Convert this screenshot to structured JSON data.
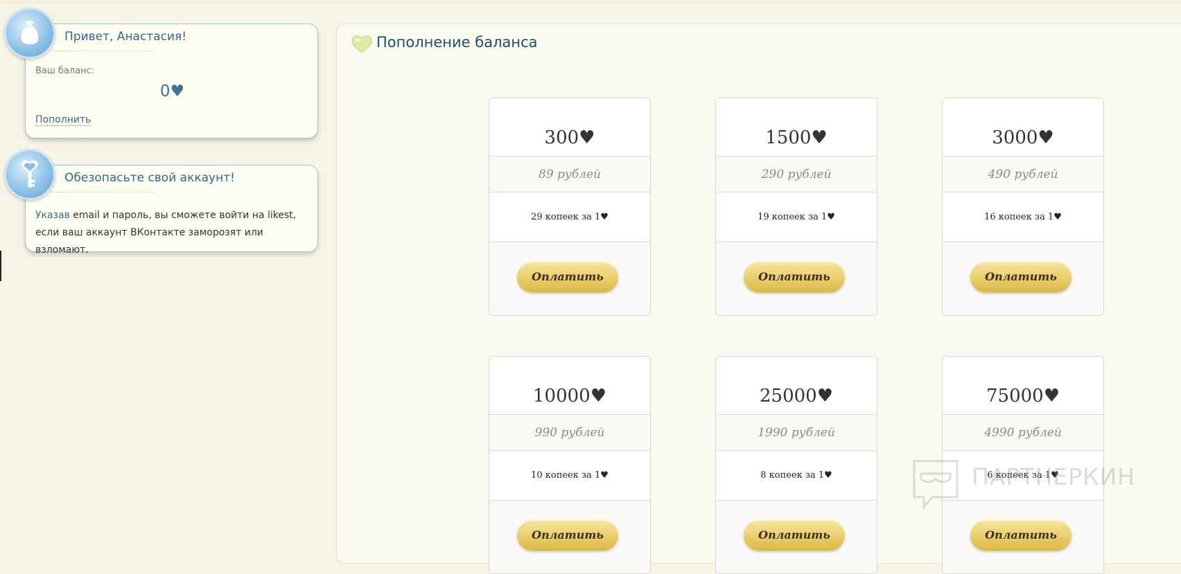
{
  "greeting": {
    "title": "Привет, Анастасия!",
    "balance_label": "Ваш баланс:",
    "balance_value": "0♥",
    "topup_link": "Пополнить"
  },
  "security": {
    "title": "Обезопасьте свой аккаунт!",
    "text_lead": "Указав",
    "text_rest": " email и пароль, вы сможете войти на likest, если ваш аккаунт ВКонтакте заморозят или взломают."
  },
  "main": {
    "title": "Пополнение баланса"
  },
  "packages": [
    {
      "amount": "300♥",
      "price": "89 рублей",
      "per_unit": "29 копеек за 1♥",
      "button": "Оплатить"
    },
    {
      "amount": "1500♥",
      "price": "290 рублей",
      "per_unit": "19 копеек за 1♥",
      "button": "Оплатить"
    },
    {
      "amount": "3000♥",
      "price": "490 рублей",
      "per_unit": "16 копеек за 1♥",
      "button": "Оплатить"
    },
    {
      "amount": "10000♥",
      "price": "990 рублей",
      "per_unit": "10 копеек за 1♥",
      "button": "Оплатить"
    },
    {
      "amount": "25000♥",
      "price": "1990 рублей",
      "per_unit": "8 копеек за 1♥",
      "button": "Оплатить"
    },
    {
      "amount": "75000♥",
      "price": "4990 рублей",
      "per_unit": "6 копеек за 1♥",
      "button": "Оплатить"
    }
  ],
  "watermark": "ПАРТНЕРКИН",
  "icons": {
    "greeting_badge": "money-bag-icon",
    "security_badge": "heart-key-icon",
    "title_icon": "heart-icon"
  },
  "colors": {
    "accent": "#2f6a86",
    "button_gold": "#ecd175",
    "panel_bg": "#fbfaf1"
  }
}
